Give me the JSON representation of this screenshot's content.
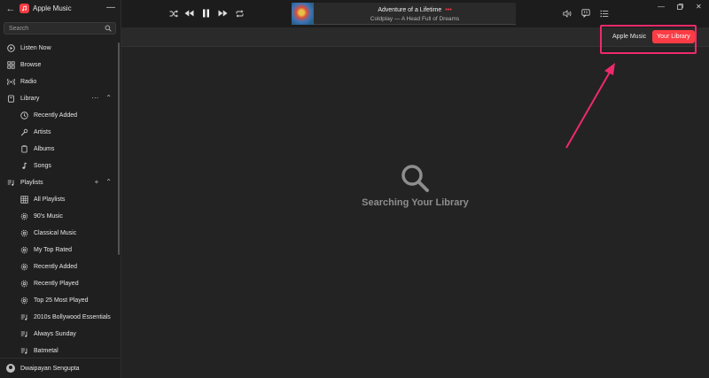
{
  "app": {
    "title": "Apple Music"
  },
  "search": {
    "placeholder": "Search"
  },
  "nav": {
    "listen_now": "Listen Now",
    "browse": "Browse",
    "radio": "Radio",
    "library": "Library",
    "library_items": [
      "Recently Added",
      "Artists",
      "Albums",
      "Songs"
    ],
    "playlists": "Playlists",
    "playlist_items": [
      "All Playlists",
      "90's Music",
      "Classical Music",
      "My Top Rated",
      "Recently Added",
      "Recently Played",
      "Top 25 Most Played",
      "2010s Bollywood Essentials",
      "Always Sunday",
      "Batmetal"
    ]
  },
  "user": {
    "name": "Dwaipayan Sengupta"
  },
  "now_playing": {
    "song": "Adventure of a Lifetime",
    "artist_album": "Coldplay — A Head Full of Dreams",
    "dots": "•••"
  },
  "segment": {
    "apple_music": "Apple Music",
    "your_library": "Your Library"
  },
  "main": {
    "empty_message": "Searching Your Library"
  },
  "colors": {
    "accent": "#fc3c44",
    "highlight": "#ee2a6a",
    "background": "#232323",
    "sidebar": "#1f1f1f"
  }
}
